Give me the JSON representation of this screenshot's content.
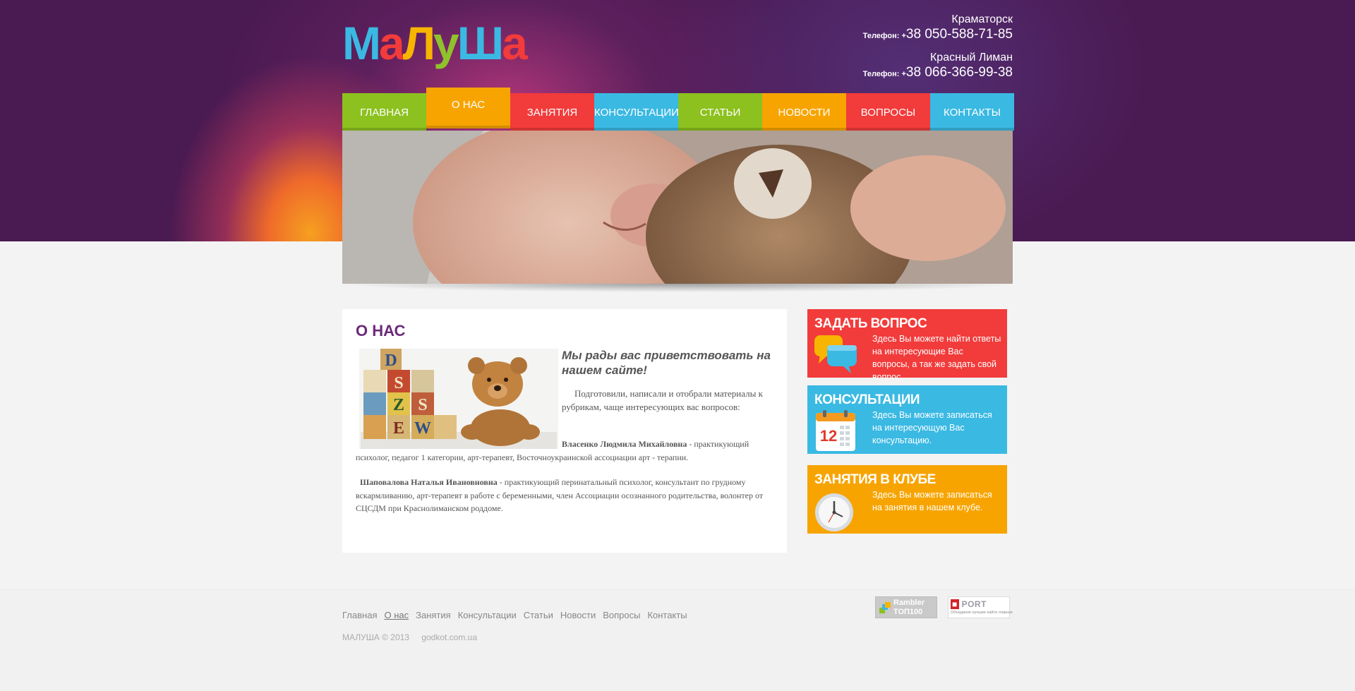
{
  "site": {
    "logo_letters": [
      {
        "char": "М",
        "color": "#3ab9e3"
      },
      {
        "char": "а",
        "color": "#f23b3b"
      },
      {
        "char": "Л",
        "color": "#f7b500"
      },
      {
        "char": "у",
        "color": "#8fc22b"
      },
      {
        "char": "Ш",
        "color": "#3ab9e3"
      },
      {
        "char": "а",
        "color": "#f23b3b"
      }
    ]
  },
  "contacts": [
    {
      "city": "Краматорск",
      "phone_label": "Телефон: +",
      "phone": "38 050-588-71-85"
    },
    {
      "city": "Красный Лиман",
      "phone_label": "Телефон: +",
      "phone": "38 066-366-99-38"
    }
  ],
  "nav": {
    "items": [
      {
        "label": "Главная",
        "color": "#8cc11f"
      },
      {
        "label": "О нас",
        "color": "#f7a400",
        "active": true
      },
      {
        "label": "Занятия",
        "color": "#f23b3b"
      },
      {
        "label": "Консультации",
        "color": "#3ab9e3"
      },
      {
        "label": "Статьи",
        "color": "#8cc11f"
      },
      {
        "label": "Новости",
        "color": "#f7a400"
      },
      {
        "label": "Вопросы",
        "color": "#f23b3b"
      },
      {
        "label": "Контакты",
        "color": "#3ab9e3"
      }
    ]
  },
  "main": {
    "title": "О НАС",
    "welcome": "Мы рады вас приветствовать на нашем сайте!",
    "para1": "Подготовили, написали и отобрали материалы к рубрикам, чаще интересующих вас вопросов:",
    "person1_name": "Власенко Людмила Михайловна",
    "person1_desc_a": " - практикующий",
    "person1_desc_b": "психолог, педагог 1 категории, арт-терапевт, Восточноукраинской ассоциации арт - терапии.",
    "person2_name": "Шаповалова  Наталья Ивановновна",
    "person2_desc": " - практикующий перинатальный психолог, консультант по грудному вскармливанию, арт-терапевт в работе с беременными, член Ассоциации осознанного родительства, волонтер от СЦСДМ при Краснолиманском роддоме."
  },
  "sidebar": [
    {
      "title": "Задать вопрос",
      "text": "Здесь Вы можете найти ответы на интересующие Вас вопросы, а так же задать свой вопрос.",
      "color": "#f23b3b",
      "icon": "speech-bubbles-icon"
    },
    {
      "title": "Консультации",
      "text": "Здесь Вы можете записаться на интересующую Вас консультацию.",
      "color": "#3ab9e3",
      "icon": "calendar-icon",
      "calendar_day": "12"
    },
    {
      "title": "Занятия в клубе",
      "text": "Здесь Вы можете записаться на занятия в нашем клубе.",
      "color": "#f7a400",
      "icon": "clock-icon"
    }
  ],
  "footer": {
    "links": [
      {
        "label": "Главная"
      },
      {
        "label": "О нас",
        "active": true
      },
      {
        "label": "Занятия"
      },
      {
        "label": "Консультации"
      },
      {
        "label": "Статьи"
      },
      {
        "label": "Новости"
      },
      {
        "label": "Вопросы"
      },
      {
        "label": "Контакты"
      }
    ],
    "copyright": "МАЛУША © 2013",
    "domain": "godkot.com.ua",
    "counter1_line1": "Rambler",
    "counter1_line2": "ТОП100",
    "counter2_logo": "PORT",
    "counter2_sub": "Объединяя лучшие найти главное"
  }
}
